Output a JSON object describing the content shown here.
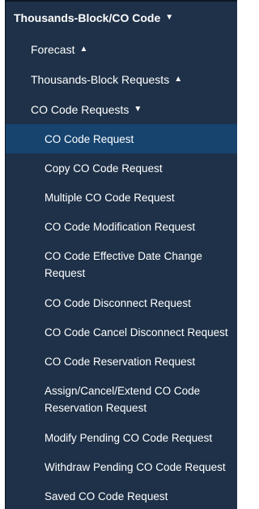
{
  "menu": {
    "title": "Thousands-Block/CO Code",
    "groups": [
      {
        "label": "Forecast"
      },
      {
        "label": "Thousands-Block Requests"
      },
      {
        "label": "CO Code Requests"
      }
    ],
    "items": [
      {
        "label": "CO Code Request"
      },
      {
        "label": "Copy CO Code Request"
      },
      {
        "label": "Multiple CO Code Request"
      },
      {
        "label": "CO Code Modification Request"
      },
      {
        "label": "CO Code Effective Date Change Request"
      },
      {
        "label": "CO Code Disconnect Request"
      },
      {
        "label": "CO Code Cancel Disconnect Request"
      },
      {
        "label": "CO Code Reservation Request"
      },
      {
        "label": "Assign/Cancel/Extend CO Code Reservation Request"
      },
      {
        "label": "Modify Pending CO Code Request"
      },
      {
        "label": "Withdraw Pending CO Code Request"
      },
      {
        "label": "Saved CO Code Request"
      }
    ],
    "active_item": "CO Code Request"
  },
  "colors": {
    "background": "#1e3148",
    "active_background": "#16446f",
    "text": "#ffffff"
  },
  "icons": {
    "collapsed": "caret-up-icon",
    "expanded": "caret-down-icon"
  }
}
